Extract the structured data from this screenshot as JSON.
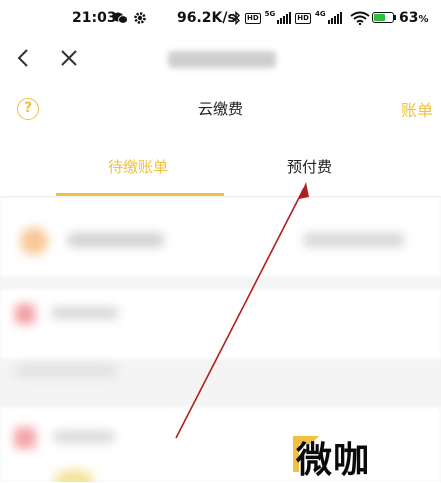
{
  "status_bar": {
    "time": "21:03",
    "net_speed": "96.2K/s",
    "hd_label": "HD",
    "sim1_label": "5G",
    "sim2_label": "4G",
    "battery_percent": "63",
    "battery_level": 0.63,
    "battery_color": "#2fbf3a"
  },
  "nav": {
    "back_icon": "chevron-left-icon",
    "close_icon": "close-icon"
  },
  "header": {
    "title": "云缴费",
    "help_icon": "question-circle-icon",
    "help_glyph": "?",
    "right_link": "账单"
  },
  "tabs": [
    {
      "label": "待缴账单",
      "active": true
    },
    {
      "label": "预付费",
      "active": false
    }
  ],
  "colors": {
    "accent": "#f0c040",
    "annotation_arrow": "#b02020"
  },
  "watermark": {
    "text": "微咖"
  }
}
